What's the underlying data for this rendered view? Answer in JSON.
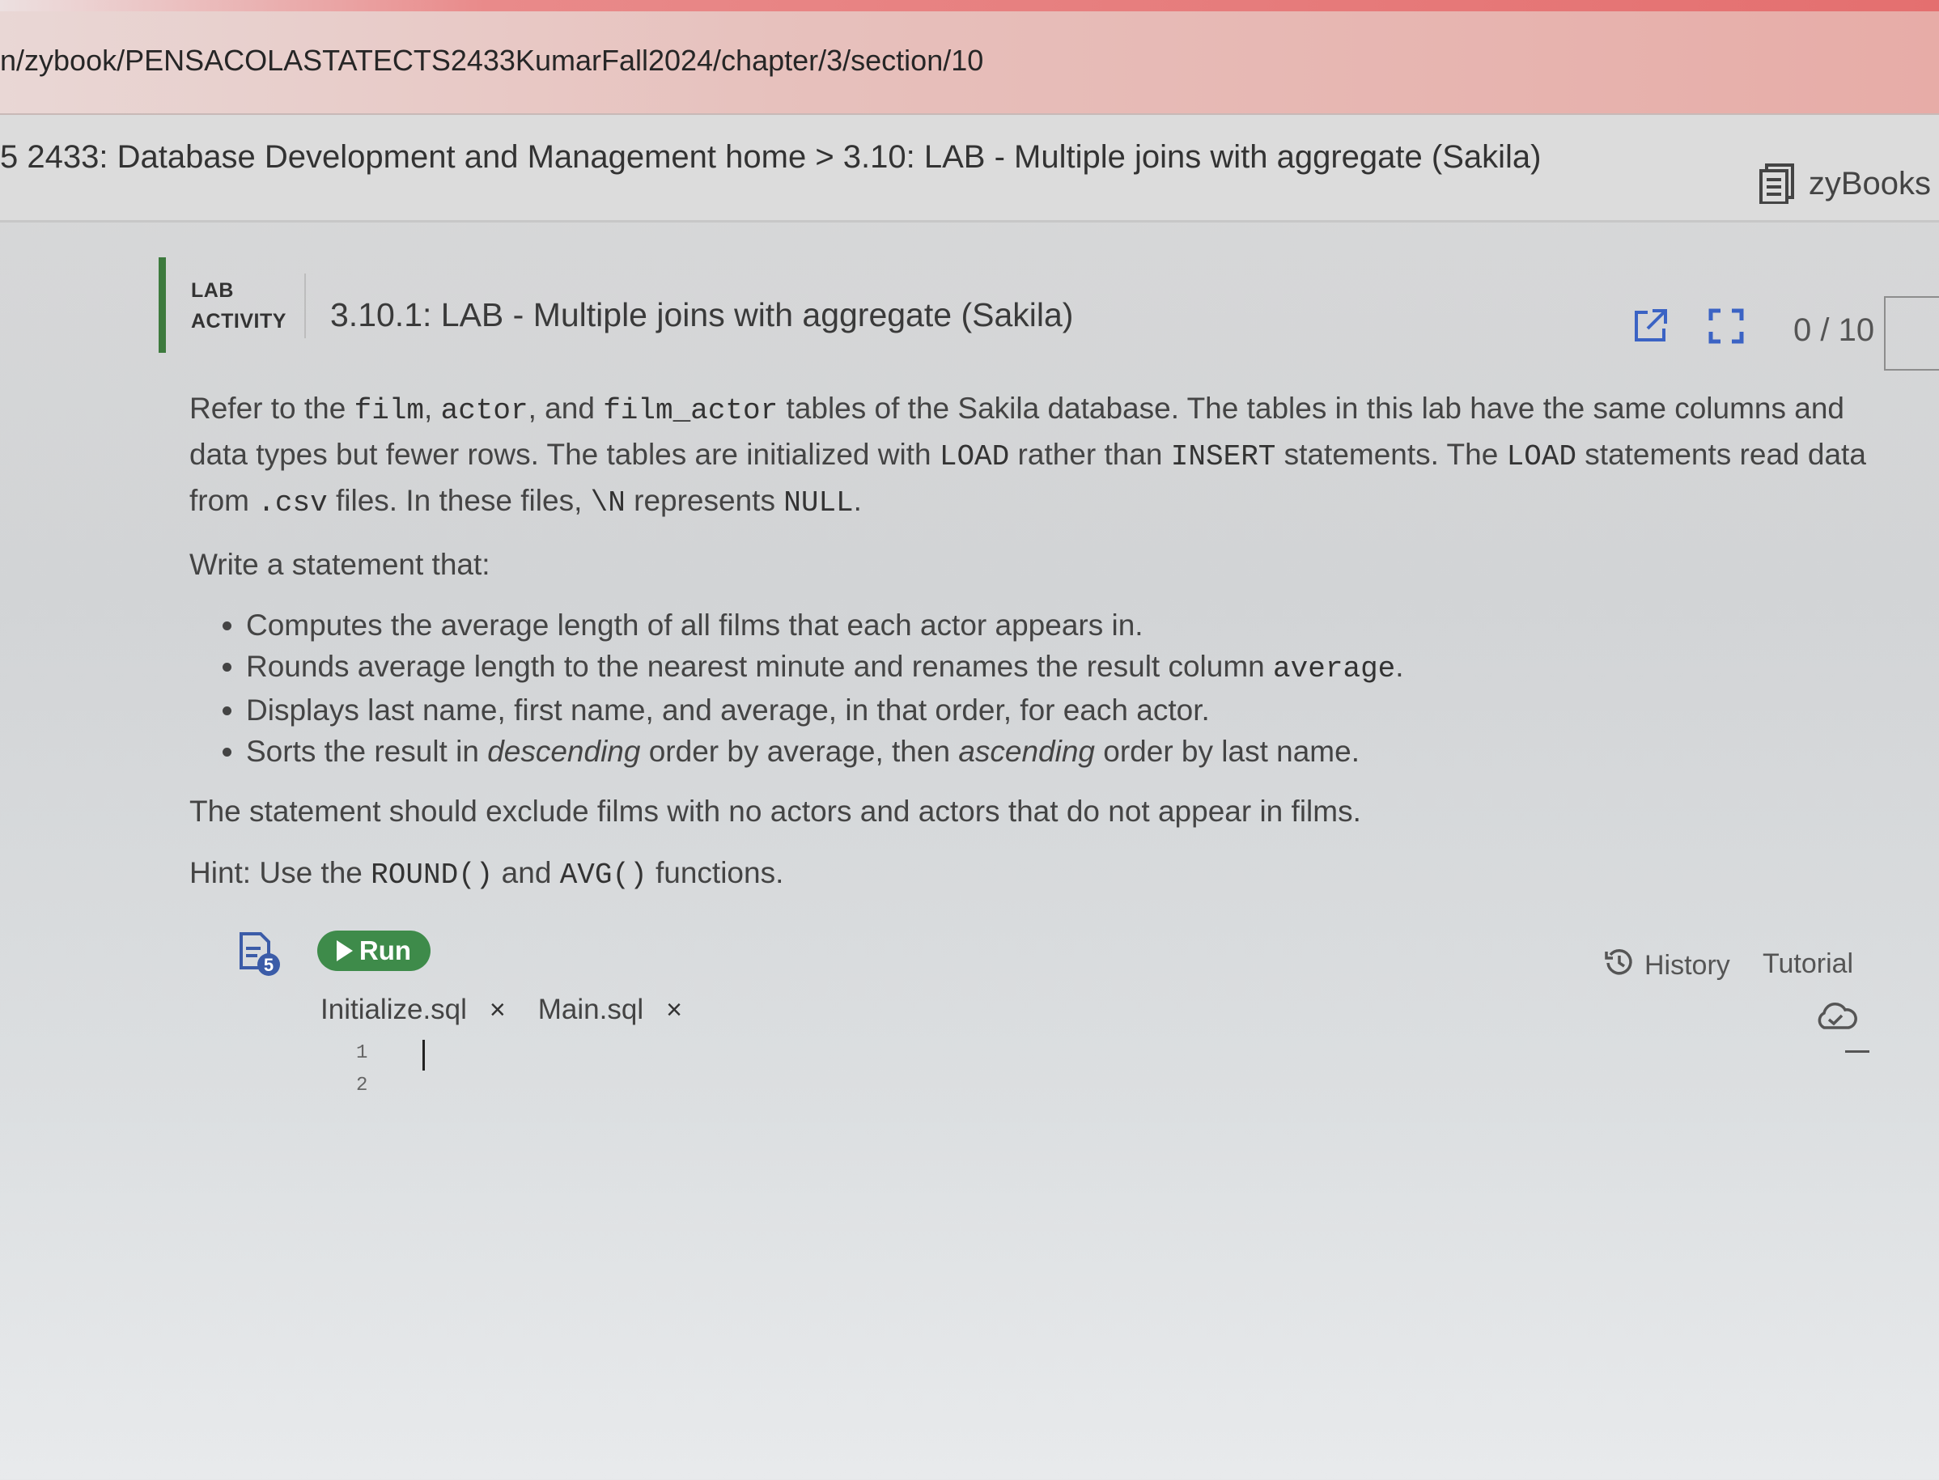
{
  "browser": {
    "url": "n/zybook/PENSACOLASTATECTS2433KumarFall2024/chapter/3/section/10"
  },
  "nav": {
    "breadcrumb": "5 2433: Database Development and Management home > 3.10: LAB - Multiple joins with aggregate (Sakila)",
    "brand": "zyBooks",
    "brand_icon": "book-icon"
  },
  "activity": {
    "label_line1": "LAB",
    "label_line2": "ACTIVITY",
    "title": "3.10.1: LAB - Multiple joins with aggregate (Sakila)",
    "score": "0 / 10",
    "accent_color": "#3d7a3d"
  },
  "instructions": {
    "p1": {
      "t1": "Refer to the ",
      "c1": "film",
      "t2": ", ",
      "c2": "actor",
      "t3": ", and ",
      "c3": "film_actor",
      "t4": " tables of the Sakila database. The tables in this lab have the same columns and data types but fewer rows. The tables are initialized with ",
      "c4": "LOAD",
      "t5": " rather than ",
      "c5": "INSERT",
      "t6": " statements. The ",
      "c6": "LOAD",
      "t7": " statements read data from ",
      "c7": ".csv",
      "t8": " files. In these files, ",
      "c8": "\\N",
      "t9": " represents ",
      "c9": "NULL",
      "t10": "."
    },
    "p2": "Write a statement that:",
    "bullets": {
      "b1": "Computes the average length of all films that each actor appears in.",
      "b2_text": "Rounds average length to the nearest minute and renames the result column ",
      "b2_code": "average",
      "b2_end": ".",
      "b3": "Displays last name, first name, and average, in that order, for each actor.",
      "b4_t1": "Sorts the result in ",
      "b4_em1": "descending",
      "b4_t2": " order by average, then ",
      "b4_em2": "ascending",
      "b4_t3": " order by last name."
    },
    "p3": "The statement should exclude films with no actors and actors that do not appear in films.",
    "hint": {
      "t1": "Hint: Use the ",
      "c1": "ROUND()",
      "t2": " and ",
      "c2": "AVG()",
      "t3": " functions."
    }
  },
  "toolbar": {
    "file_badge": "5",
    "run_label": "Run",
    "history_label": "History",
    "tutorial_label": "Tutorial",
    "run_color": "#3e8b4a"
  },
  "editor": {
    "tabs": [
      {
        "name": "Initialize.sql",
        "close": "×"
      },
      {
        "name": "Main.sql",
        "close": "×"
      }
    ],
    "line_numbers": [
      "1",
      "2"
    ]
  }
}
